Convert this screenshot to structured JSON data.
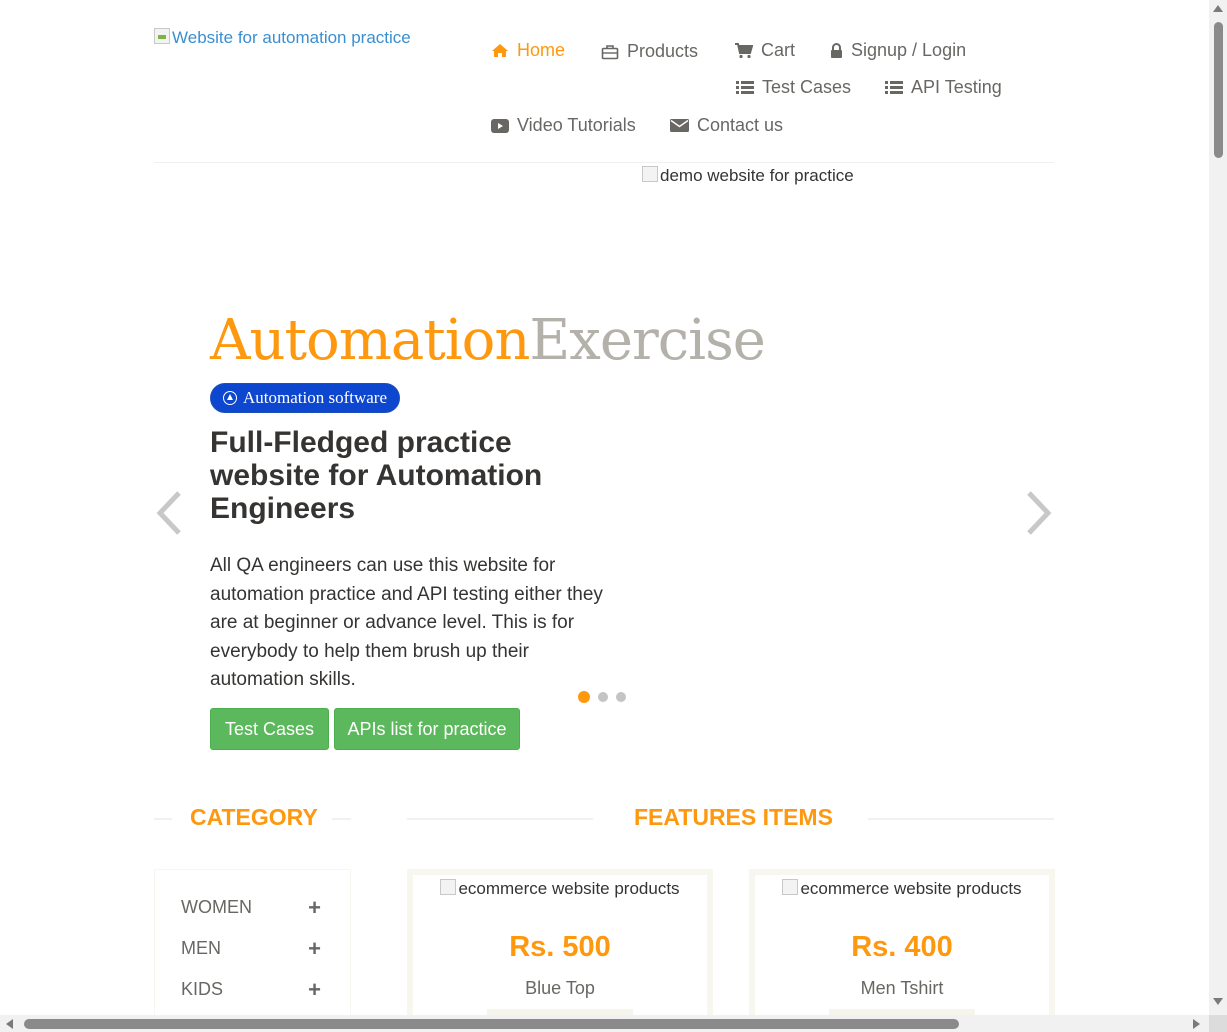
{
  "header": {
    "logo_alt": "Website for automation practice",
    "nav": {
      "home": "Home",
      "products": "Products",
      "cart": "Cart",
      "signup_login": "Signup / Login",
      "test_cases": "Test Cases",
      "api_testing": "API Testing",
      "video_tutorials": "Video Tutorials",
      "contact_us": "Contact us"
    },
    "icons": [
      "home-icon",
      "briefcase-icon",
      "shopping-cart-icon",
      "lock-icon",
      "list-icon",
      "list-icon",
      "youtube-play-icon",
      "envelope-icon"
    ]
  },
  "slider": {
    "image_alt": "demo website for practice",
    "brand_part1": "Automation",
    "brand_part2": "Exercise",
    "badge": "Automation software",
    "title": "Full-Fledged practice website for Automation Engineers",
    "text": "All QA engineers can use this website for automation practice and API testing either they are at beginner or advance level. This is for everybody to help them brush up their automation skills.",
    "buttons": {
      "test_cases": "Test Cases",
      "apis_list": "APIs list for practice"
    },
    "active_slide_index": 0,
    "slide_count": 3
  },
  "sidebar": {
    "heading": "CATEGORY",
    "categories": [
      {
        "label": "WOMEN"
      },
      {
        "label": "MEN"
      },
      {
        "label": "KIDS"
      }
    ]
  },
  "features": {
    "heading": "FEATURES ITEMS",
    "products": [
      {
        "image_alt": "ecommerce website products",
        "price": "Rs. 500",
        "name": "Blue Top"
      },
      {
        "image_alt": "ecommerce website products",
        "price": "Rs. 400",
        "name": "Men Tshirt"
      }
    ]
  },
  "colors": {
    "accent": "#fe980f",
    "text": "#696763",
    "heading_text": "#363432",
    "button_green": "#5cb85c",
    "badge_blue": "#0d47cf",
    "brand_grey": "#b4b1ab"
  }
}
